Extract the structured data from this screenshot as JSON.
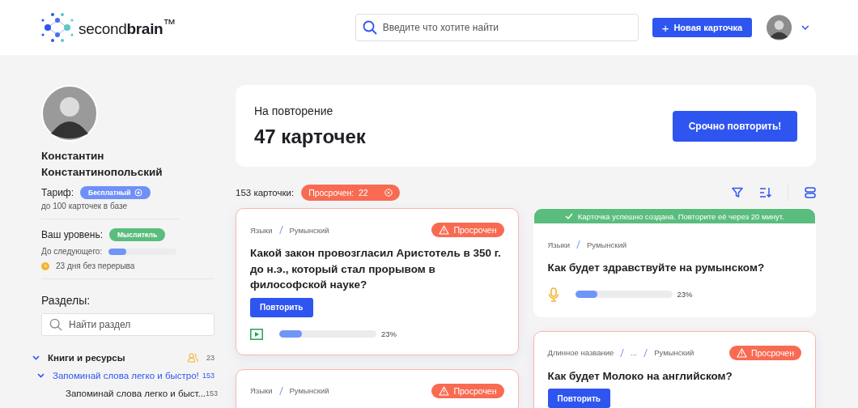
{
  "header": {
    "logo": "second**brain**$^{™}$",
    "search": {
      "placeholder": "Введите что хотите найти"
    },
    "new_button": {
      "icon": "+",
      "label": "Новая карточка"
    }
  },
  "profile": {
    "name": "Константин Константинопольский",
    "tariff_label": "Тариф:",
    "tariff": "Бесплатный",
    "tariff_note": "до 100 карточек в базе",
    "level_label": "Ваш уровень:",
    "level_badge": "Мыслитель",
    "next_label": "До следующего:",
    "level": 0.26,
    "streak": "23 дня без перерыва"
  },
  "sections": {
    "title": "Разделы:",
    "search": {
      "placeholder": "Найти раздел"
    },
    "tree": [
      {
        "label": "Книги и ресурсы",
        "count": "23",
        "shared": true,
        "expanded": true,
        "selected": false,
        "children": [
          {
            "label": "Запоминай слова легко и быстро!",
            "count": "153",
            "shared": false,
            "expanded": true,
            "selected": true,
            "children": [
              {
                "label": "Запоминай слова легко и быст...",
                "count": "153",
                "shared": false,
                "selected": false
              }
            ]
          }
        ]
      }
    ]
  },
  "review": {
    "label": "На повторение",
    "count": "47 карточек",
    "button": "Срочно повторить!"
  },
  "toolbar": {
    "total": "153 карточки:",
    "filter_chip": "Просрочен:  22"
  },
  "card_columns": [
    {
      "cards": [
        {
          "path": [
            "Языки",
            "Румынский"
          ],
          "overdue": true,
          "badge": "Просрочен",
          "question": "Какой закон провозгласил Аристотель в 350 г. до н.э., который стал прорывом в философской науке?",
          "button": "Повторить",
          "kind": "video",
          "level": 0.23,
          "reading": "23%"
        },
        {
          "path": [
            "Языки",
            "Румынский"
          ],
          "overdue": true,
          "badge": "Просрочен"
        }
      ]
    },
    {
      "cards": [
        {
          "banner": "Карточка успешно создана. Повторите её через 20 минут.",
          "path": [
            "Языки",
            "Румынский"
          ],
          "overdue": false,
          "question": "Как будет здравствуйте на румынском?",
          "kind": "mic",
          "level": 0.23,
          "reading": "23%"
        },
        {
          "path": [
            "Длинное название",
            "...",
            "Румынский"
          ],
          "overdue": true,
          "badge": "Просрочен",
          "question": "Как будет Молоко на английском?",
          "button": "Повторить"
        }
      ]
    }
  ]
}
